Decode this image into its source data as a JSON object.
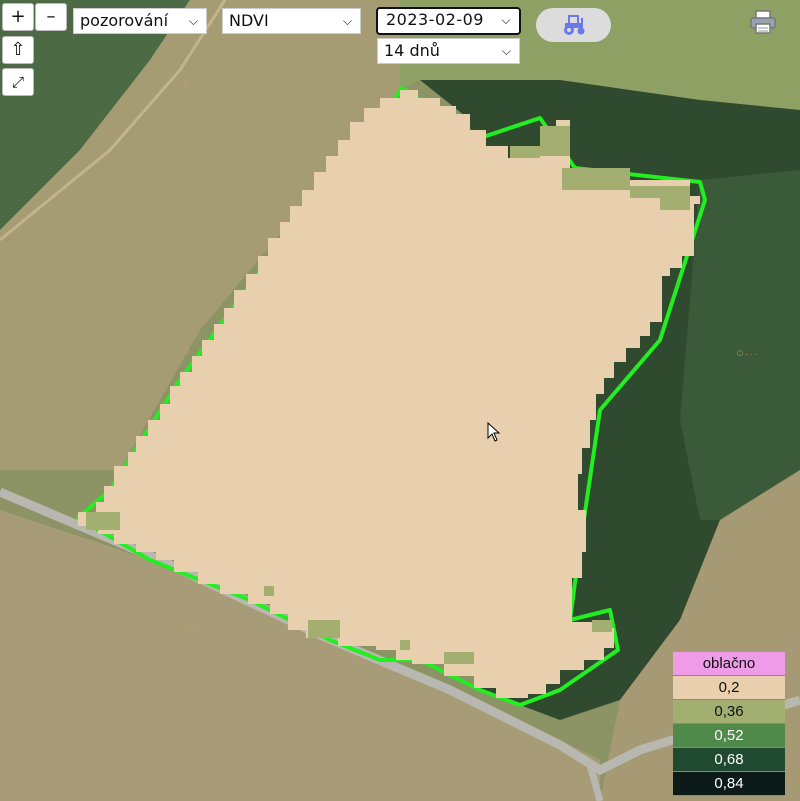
{
  "controls": {
    "zoom_in": "+",
    "zoom_out": "–",
    "home": "⇧",
    "fullscreen": "⤢"
  },
  "toolbar": {
    "mode_select": "pozorování",
    "index_select": "NDVI",
    "date_select": "2023-02-09",
    "period_select": "14 dnů",
    "tractor_icon": "tractor-icon",
    "print_icon": "printer-icon"
  },
  "legend": {
    "items": [
      {
        "label": "oblačno",
        "color": "#ee9ce8",
        "text_color": "#111"
      },
      {
        "label": "0,2",
        "color": "#e8cfad",
        "text_color": "#111"
      },
      {
        "label": "0,36",
        "color": "#a2af70",
        "text_color": "#111"
      },
      {
        "label": "0,52",
        "color": "#4f8a4a",
        "text_color": "#fff"
      },
      {
        "label": "0,68",
        "color": "#1f4a30",
        "text_color": "#fff"
      },
      {
        "label": "0,84",
        "color": "#0c1a18",
        "text_color": "#fff"
      }
    ]
  },
  "colors": {
    "field_boundary": "#22ee22",
    "ndvi_low": "#e8cfad",
    "ndvi_mid": "#a2af70"
  }
}
